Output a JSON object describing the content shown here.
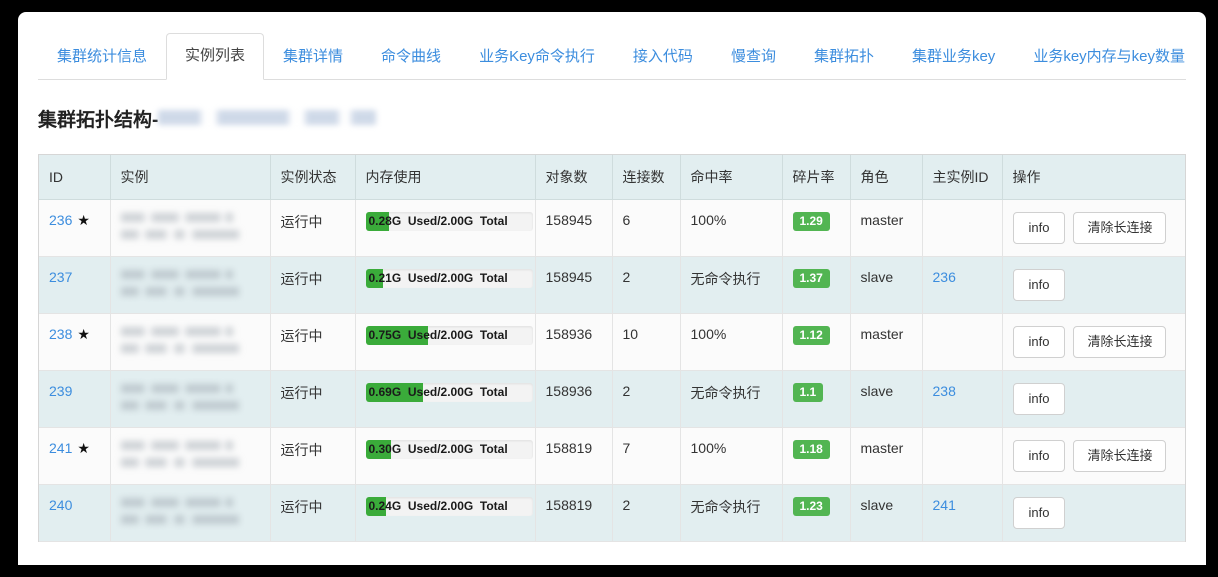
{
  "tabs": [
    {
      "label": "集群统计信息",
      "active": false
    },
    {
      "label": "实例列表",
      "active": true
    },
    {
      "label": "集群详情",
      "active": false
    },
    {
      "label": "命令曲线",
      "active": false
    },
    {
      "label": "业务Key命令执行",
      "active": false
    },
    {
      "label": "接入代码",
      "active": false
    },
    {
      "label": "慢查询",
      "active": false
    },
    {
      "label": "集群拓扑",
      "active": false
    },
    {
      "label": "集群业务key",
      "active": false
    },
    {
      "label": "业务key内存与key数量",
      "active": false
    }
  ],
  "page_title": "集群拓扑结构-",
  "table": {
    "headers": [
      "ID",
      "实例",
      "实例状态",
      "内存使用",
      "对象数",
      "连接数",
      "命中率",
      "碎片率",
      "角色",
      "主实例ID",
      "操作"
    ],
    "rows": [
      {
        "id": "236",
        "starred": true,
        "instance": "",
        "state": "运行中",
        "mem_used": "0.28G",
        "mem_used_label": "0.28G  Used/2.00G  Total",
        "mem_percent": 14,
        "objects": "158945",
        "connections": "6",
        "hit_rate": "100%",
        "frag_rate": "1.29",
        "role": "master",
        "master_id": "",
        "actions": [
          "info",
          "清除长连接"
        ]
      },
      {
        "id": "237",
        "starred": false,
        "instance": "",
        "state": "运行中",
        "mem_used": "0.21G",
        "mem_used_label": "0.21G  Used/2.00G  Total",
        "mem_percent": 10.5,
        "objects": "158945",
        "connections": "2",
        "hit_rate": "无命令执行",
        "frag_rate": "1.37",
        "role": "slave",
        "master_id": "236",
        "actions": [
          "info"
        ]
      },
      {
        "id": "238",
        "starred": true,
        "instance": "",
        "state": "运行中",
        "mem_used": "0.75G",
        "mem_used_label": "0.75G  Used/2.00G  Total",
        "mem_percent": 37.5,
        "objects": "158936",
        "connections": "10",
        "hit_rate": "100%",
        "frag_rate": "1.12",
        "role": "master",
        "master_id": "",
        "actions": [
          "info",
          "清除长连接"
        ]
      },
      {
        "id": "239",
        "starred": false,
        "instance": "",
        "state": "运行中",
        "mem_used": "0.69G",
        "mem_used_label": "0.69G  Used/2.00G  Total",
        "mem_percent": 34.5,
        "objects": "158936",
        "connections": "2",
        "hit_rate": "无命令执行",
        "frag_rate": "1.1",
        "role": "slave",
        "master_id": "238",
        "actions": [
          "info"
        ]
      },
      {
        "id": "241",
        "starred": true,
        "instance": "",
        "state": "运行中",
        "mem_used": "0.30G",
        "mem_used_label": "0.30G  Used/2.00G  Total",
        "mem_percent": 15,
        "objects": "158819",
        "connections": "7",
        "hit_rate": "100%",
        "frag_rate": "1.18",
        "role": "master",
        "master_id": "",
        "actions": [
          "info",
          "清除长连接"
        ]
      },
      {
        "id": "240",
        "starred": false,
        "instance": "",
        "state": "运行中",
        "mem_used": "0.24G",
        "mem_used_label": "0.24G  Used/2.00G  Total",
        "mem_percent": 12,
        "objects": "158819",
        "connections": "2",
        "hit_rate": "无命令执行",
        "frag_rate": "1.23",
        "role": "slave",
        "master_id": "241",
        "actions": [
          "info"
        ]
      }
    ]
  },
  "colors": {
    "tab_link": "#3c8dde",
    "header_bg": "#e2eef0",
    "row_even_bg": "#e2eef0",
    "row_odd_bg": "#fbfbfb",
    "badge_green": "#52b552",
    "mem_fill_green": "#3aab3a",
    "link_blue": "#3c8dde"
  },
  "icons": {
    "star": "★"
  }
}
